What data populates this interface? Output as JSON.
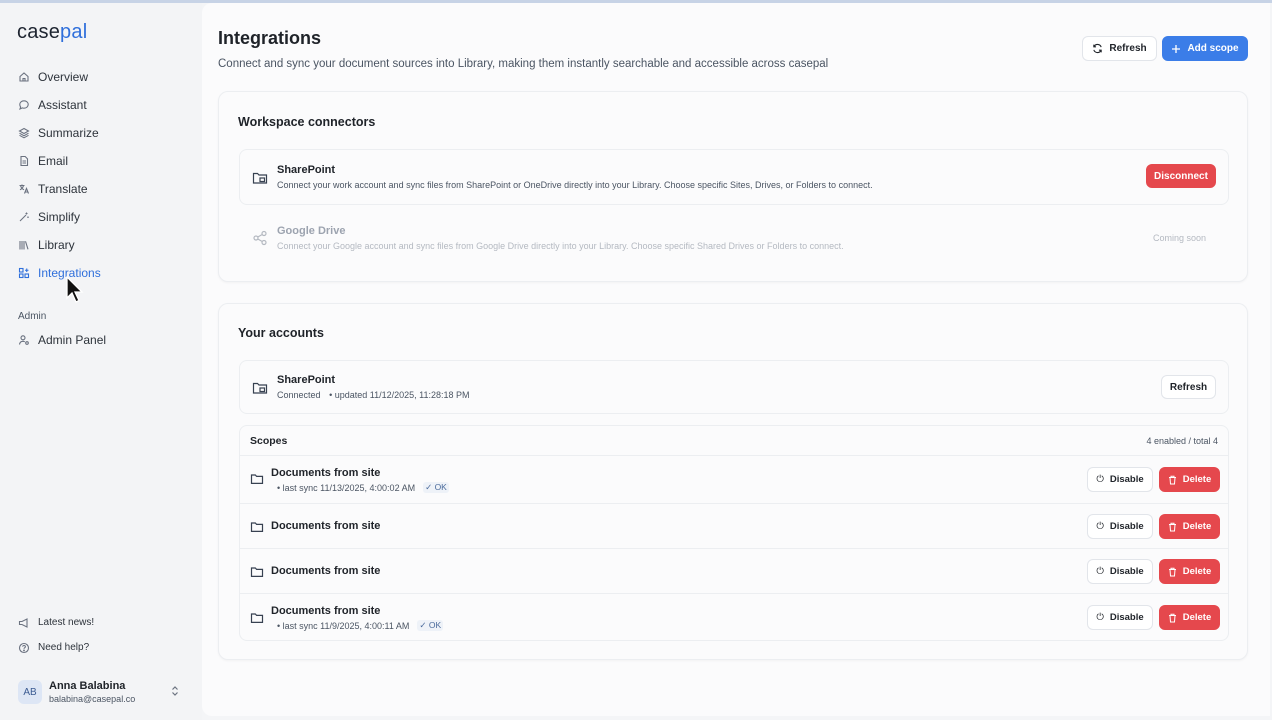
{
  "app": {
    "logo_part1": "case",
    "logo_part2": "pal",
    "accent": "#2f6fdb"
  },
  "sidebar": {
    "items": [
      {
        "label": "Overview",
        "icon": "home-icon"
      },
      {
        "label": "Assistant",
        "icon": "chat-icon"
      },
      {
        "label": "Summarize",
        "icon": "layers-icon"
      },
      {
        "label": "Email",
        "icon": "document-icon"
      },
      {
        "label": "Translate",
        "icon": "translate-icon"
      },
      {
        "label": "Simplify",
        "icon": "magic-wand-icon"
      },
      {
        "label": "Library",
        "icon": "library-icon"
      },
      {
        "label": "Integrations",
        "icon": "integrations-icon",
        "active": true
      }
    ],
    "admin_label": "Admin",
    "admin_items": [
      {
        "label": "Admin Panel",
        "icon": "user-cog-icon"
      }
    ],
    "footer_items": [
      {
        "label": "Latest news!",
        "icon": "megaphone-icon"
      },
      {
        "label": "Need help?",
        "icon": "help-circle-icon"
      }
    ],
    "user": {
      "initials": "AB",
      "name": "Anna Balabina",
      "email": "balabina@casepal.co"
    }
  },
  "header": {
    "title": "Integrations",
    "subtitle": "Connect and sync your document sources into Library, making them instantly searchable and accessible across casepal",
    "refresh_label": "Refresh",
    "add_scope_label": "Add scope"
  },
  "workspace": {
    "title": "Workspace connectors",
    "connectors": [
      {
        "name": "SharePoint",
        "description": "Connect your work account and sync files from SharePoint or OneDrive directly into your Library. Choose specific Sites, Drives, or Folders to connect.",
        "action": "Disconnect"
      },
      {
        "name": "Google Drive",
        "description": "Connect your Google account and sync files from Google Drive directly into your Library. Choose specific Shared Drives or Folders to connect.",
        "status": "Coming soon"
      }
    ]
  },
  "accounts": {
    "title": "Your accounts",
    "account": {
      "name": "SharePoint",
      "status": "Connected",
      "updated": "• updated 11/12/2025, 11:28:18 PM",
      "refresh_label": "Refresh"
    },
    "scopes_label": "Scopes",
    "scopes_count": "4 enabled / total 4",
    "disable_label": "Disable",
    "delete_label": "Delete",
    "scopes": [
      {
        "title": "Documents from site",
        "meta": "• last sync 11/13/2025, 4:00:02 AM",
        "ok": "OK"
      },
      {
        "title": "Documents from site"
      },
      {
        "title": "Documents from site"
      },
      {
        "title": "Documents from site",
        "meta": "• last sync 11/9/2025, 4:00:11 AM",
        "ok": "OK"
      }
    ]
  },
  "colors": {
    "primary": "#3b7de8",
    "danger": "#e5484d"
  }
}
